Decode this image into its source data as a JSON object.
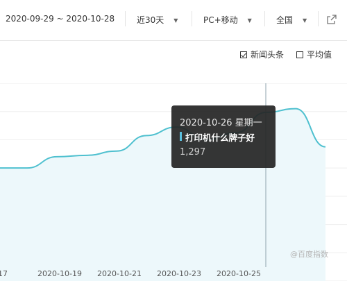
{
  "toolbar": {
    "date_range": "2020-09-29 ~ 2020-10-28",
    "period": "近30天",
    "device": "PC+移动",
    "region": "全国"
  },
  "options": {
    "news": {
      "label": "新闻头条",
      "checked": true
    },
    "average": {
      "label": "平均值",
      "checked": false
    }
  },
  "tooltip": {
    "date": "2020-10-26 星期一",
    "series": "打印机什么牌子好",
    "value": "1,297"
  },
  "watermark": "@百度指数",
  "colors": {
    "line": "#4ec0cf",
    "area": "#edf8fb",
    "tooltip_bg": "#262626",
    "tooltip_marker": "#5bc0de"
  },
  "chart_data": {
    "type": "area",
    "series": [
      {
        "name": "打印机什么牌子好",
        "x": [
          "2020-10-17",
          "2020-10-18",
          "2020-10-19",
          "2020-10-20",
          "2020-10-21",
          "2020-10-22",
          "2020-10-23",
          "2020-10-24",
          "2020-10-25",
          "2020-10-26",
          "2020-10-27",
          "2020-10-28"
        ],
        "y": [
          1100,
          1100,
          1140,
          1145,
          1160,
          1215,
          1245,
          1200,
          1225,
          1297,
          1310,
          1175
        ]
      }
    ],
    "x_tick_labels": [
      "17",
      "2020-10-19",
      "2020-10-21",
      "2020-10-23",
      "2020-10-25"
    ],
    "highlight": {
      "x": "2020-10-26",
      "y": 1297
    },
    "ylim": [
      700,
      1400
    ]
  }
}
